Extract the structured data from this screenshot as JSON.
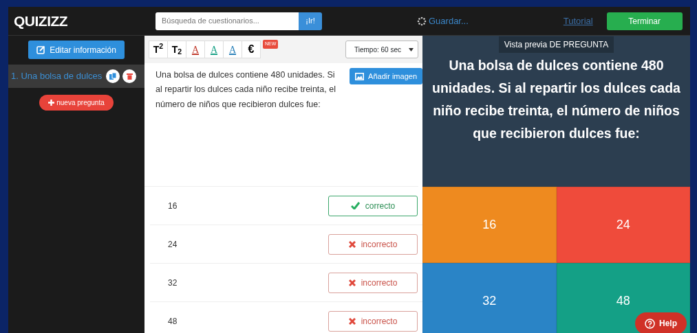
{
  "topbar": {
    "logo": "QUIZIZZ",
    "search": {
      "placeholder": "Búsqueda de cuestionarios...",
      "button": "¡Ir!"
    },
    "status": "Guardar...",
    "tutorial": "Tutorial",
    "finish": "Terminar"
  },
  "sidebar": {
    "edit_button": "Editar información",
    "questions": [
      {
        "label": "1. Una bolsa de dulces",
        "selected": true
      }
    ],
    "new_button": "nueva pregunta"
  },
  "toolbar": {
    "buttons": [
      {
        "kind": "sup",
        "label": "T$^{2}$"
      },
      {
        "kind": "sub",
        "label": "T$_{2}$"
      },
      {
        "kind": "color",
        "label": "A",
        "color": "#c0392b"
      },
      {
        "kind": "color",
        "label": "A",
        "color": "#16a085"
      },
      {
        "kind": "color",
        "label": "A",
        "color": "#2980b9"
      },
      {
        "kind": "text",
        "label": "€"
      }
    ],
    "new_badge": "NEW",
    "timer": "Tiempo: 60 sec"
  },
  "question": {
    "text": "Una bolsa de dulces contiene 480 unidades. Si al repartir los dulces cada niño recibe treinta, el número de niños que recibieron dulces fue:",
    "image_button": "Añadir imagen"
  },
  "answers": [
    {
      "text": "16",
      "correct": true,
      "label": "correcto"
    },
    {
      "text": "24",
      "correct": false,
      "label": "incorrecto"
    },
    {
      "text": "32",
      "correct": false,
      "label": "incorrecto"
    },
    {
      "text": "48",
      "correct": false,
      "label": "incorrecto"
    }
  ],
  "preview": {
    "header": "Vista previa DE PREGUNTA",
    "question": "Una bolsa de dulces contiene 480 unidades. Si al repartir los dulces cada niño recibe treinta, el número de niños que recibieron dulces fue:",
    "tiles": [
      {
        "text": "16",
        "color": "#ee8a1f"
      },
      {
        "text": "24",
        "color": "#ef4b3b"
      },
      {
        "text": "32",
        "color": "#2a84c6"
      },
      {
        "text": "48",
        "color": "#14a086"
      }
    ]
  },
  "help_button": "Help"
}
